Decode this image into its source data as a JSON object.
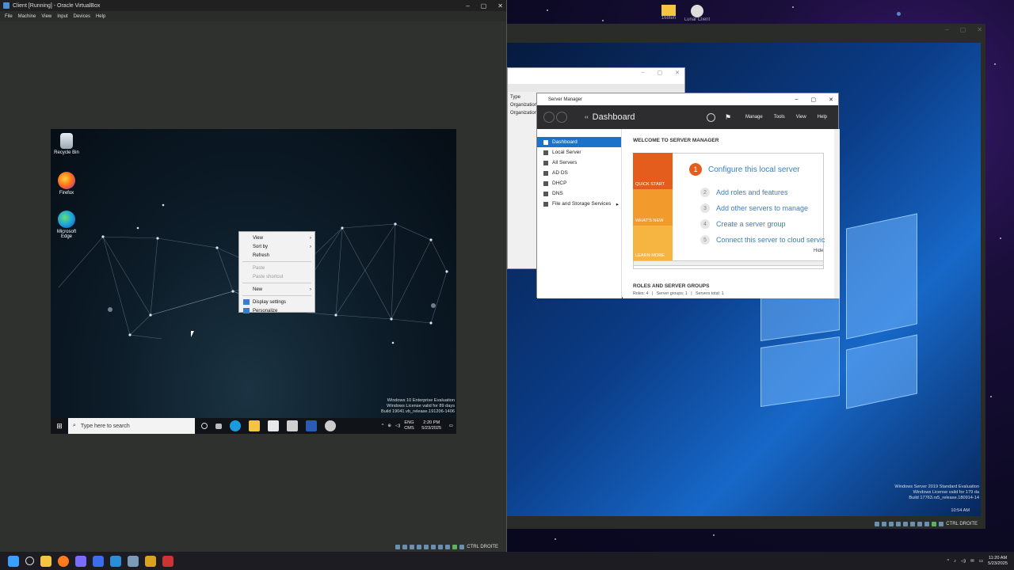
{
  "vbox_left": {
    "title": "Client [Running] - Oracle VirtualBox",
    "menu": [
      "File",
      "Machine",
      "View",
      "Input",
      "Devices",
      "Help"
    ],
    "host_key": "CTRL DROITE"
  },
  "win10": {
    "desktop_icons": [
      "Recycle Bin",
      "Firefox",
      "Microsoft Edge"
    ],
    "context_menu": {
      "items": [
        "View",
        "Sort by",
        "Refresh",
        "Paste",
        "Paste shortcut",
        "New",
        "Display settings",
        "Personalize"
      ]
    },
    "watermark": [
      "Windows 10 Enterprise Evaluation",
      "Windows License valid for 89 days",
      "Build 19041.vb_release.191206-1406"
    ],
    "search_placeholder": "Type here to search",
    "tray": {
      "lang1": "ENG",
      "lang2": "CMS",
      "time": "2:20 PM",
      "date": "5/23/2025"
    }
  },
  "vbox_right": {
    "host_key": "CTRL DROITE",
    "watermark": [
      "Windows Server 2019 Standard Evaluation",
      "Windows License valid for 179 da",
      "Build 17763.rs5_release.180914-14"
    ],
    "time": "10:54 AM"
  },
  "bg_window": {
    "column": "Type",
    "rows": [
      "Organization",
      "Organization"
    ]
  },
  "server_manager": {
    "title": "Server Manager",
    "breadcrumb": "Dashboard",
    "menu": [
      "Manage",
      "Tools",
      "View",
      "Help"
    ],
    "nav": [
      "Dashboard",
      "Local Server",
      "All Servers",
      "AD DS",
      "DHCP",
      "DNS",
      "File and Storage Services"
    ],
    "welcome": "WELCOME TO SERVER MANAGER",
    "tiles": [
      "QUICK START",
      "WHAT'S NEW",
      "LEARN MORE"
    ],
    "step1": "Configure this local server",
    "steps": [
      "Add roles and features",
      "Add other servers to manage",
      "Create a server group",
      "Connect this server to cloud servic"
    ],
    "step_nums": [
      "1",
      "2",
      "3",
      "4",
      "5"
    ],
    "hide": "Hide",
    "roles_header": "ROLES AND SERVER GROUPS",
    "roles_sub": "Roles: 4   |   Server groups: 1   |   Servers total: 1"
  },
  "host": {
    "desktop_items": [
      "168teh",
      "Lunar Client"
    ],
    "time": "11:20 AM",
    "date": "5/23/2025"
  }
}
